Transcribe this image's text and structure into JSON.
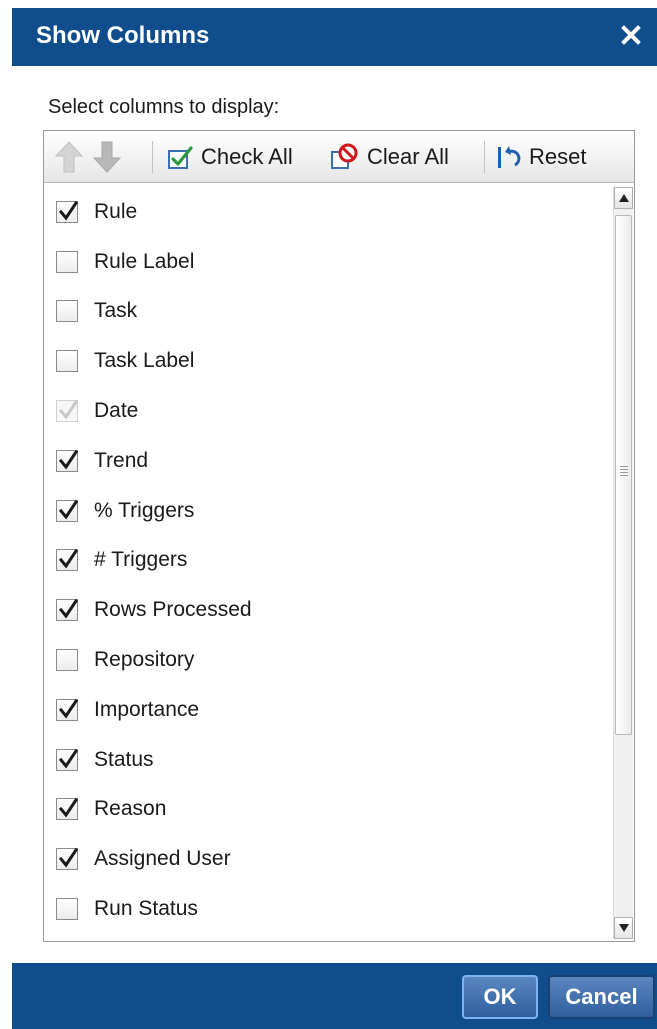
{
  "dialog": {
    "title": "Show Columns",
    "close_icon": "close-icon",
    "prompt": "Select columns to display:"
  },
  "toolbar": {
    "move_up_icon": "arrow-up-icon",
    "move_down_icon": "arrow-down-icon",
    "check_all_label": "Check All",
    "clear_all_label": "Clear All",
    "reset_label": "Reset"
  },
  "columns": [
    {
      "label": "Rule",
      "checked": true,
      "disabled": false
    },
    {
      "label": "Rule Label",
      "checked": false,
      "disabled": false
    },
    {
      "label": "Task",
      "checked": false,
      "disabled": false
    },
    {
      "label": "Task Label",
      "checked": false,
      "disabled": false
    },
    {
      "label": "Date",
      "checked": true,
      "disabled": true
    },
    {
      "label": "Trend",
      "checked": true,
      "disabled": false
    },
    {
      "label": "% Triggers",
      "checked": true,
      "disabled": false
    },
    {
      "label": "# Triggers",
      "checked": true,
      "disabled": false
    },
    {
      "label": "Rows Processed",
      "checked": true,
      "disabled": false
    },
    {
      "label": "Repository",
      "checked": false,
      "disabled": false
    },
    {
      "label": "Importance",
      "checked": true,
      "disabled": false
    },
    {
      "label": "Status",
      "checked": true,
      "disabled": false
    },
    {
      "label": "Reason",
      "checked": true,
      "disabled": false
    },
    {
      "label": "Assigned User",
      "checked": true,
      "disabled": false
    },
    {
      "label": "Run Status",
      "checked": false,
      "disabled": false
    }
  ],
  "footer": {
    "ok_label": "OK",
    "cancel_label": "Cancel"
  },
  "colors": {
    "titlebar": "#0f4d8d",
    "check_all_icon": "#2a9a3a",
    "clear_all_icon": "#d0161b",
    "reset_icon": "#1f5fb0"
  }
}
